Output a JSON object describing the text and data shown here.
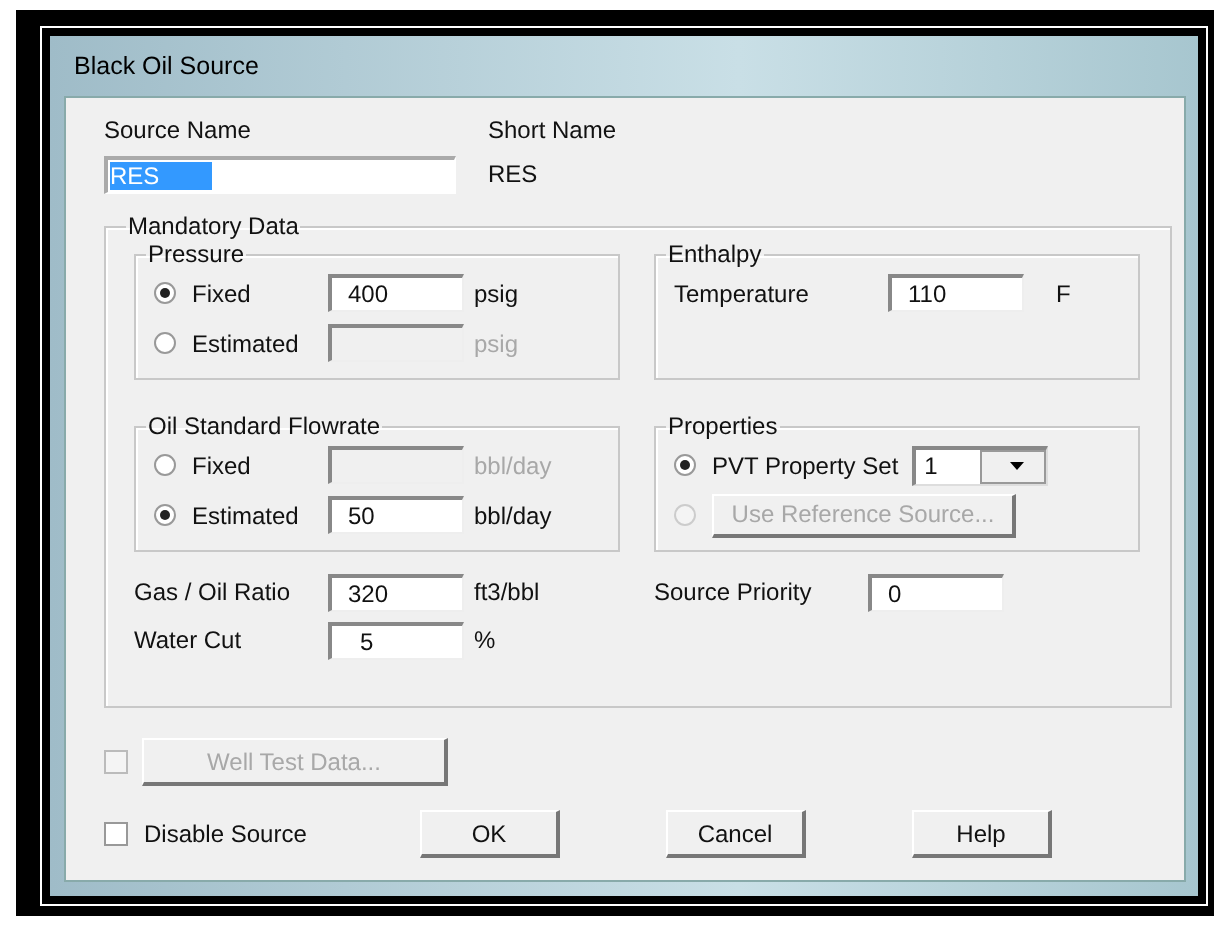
{
  "window": {
    "title": "Black Oil Source"
  },
  "source_name": {
    "label": "Source Name",
    "value": "RES",
    "selected": true
  },
  "short_name": {
    "label": "Short Name",
    "value": "RES"
  },
  "mandatory_data": {
    "title": "Mandatory Data",
    "pressure": {
      "title": "Pressure",
      "options": [
        {
          "label": "Fixed",
          "selected": true,
          "value": "400",
          "unit": "psig",
          "disabled": false
        },
        {
          "label": "Estimated",
          "selected": false,
          "unit": "psig",
          "disabled": true
        }
      ]
    },
    "enthalpy": {
      "title": "Enthalpy",
      "label": "Temperature",
      "value": "110",
      "unit": "F"
    },
    "oil_standard_flowrate": {
      "title": "Oil Standard Flowrate",
      "options": [
        {
          "label": "Fixed",
          "selected": false,
          "unit": "bbl/day",
          "disabled": true
        },
        {
          "label": "Estimated",
          "selected": true,
          "value": "50",
          "unit": "bbl/day",
          "disabled": false
        }
      ]
    },
    "properties": {
      "title": "Properties",
      "options": [
        {
          "kind": "dropdown",
          "label": "PVT Property Set",
          "selected": true,
          "value": "1",
          "disabled": false
        },
        {
          "kind": "button",
          "label": "Use Reference Source...",
          "selected": false,
          "disabled": true
        }
      ]
    },
    "gas_oil_ratio": {
      "label": "Gas / Oil Ratio",
      "value": "320",
      "unit": "ft3/bbl"
    },
    "water_cut": {
      "label": "Water Cut",
      "value": "5",
      "unit": "%"
    },
    "source_priority": {
      "label": "Source Priority",
      "value": "0"
    }
  },
  "well_test": {
    "checked": false,
    "label": "Well Test Data...",
    "disabled": true
  },
  "disable_source": {
    "label": "Disable Source",
    "checked": false
  },
  "buttons": [
    "OK",
    "Cancel",
    "Help"
  ]
}
